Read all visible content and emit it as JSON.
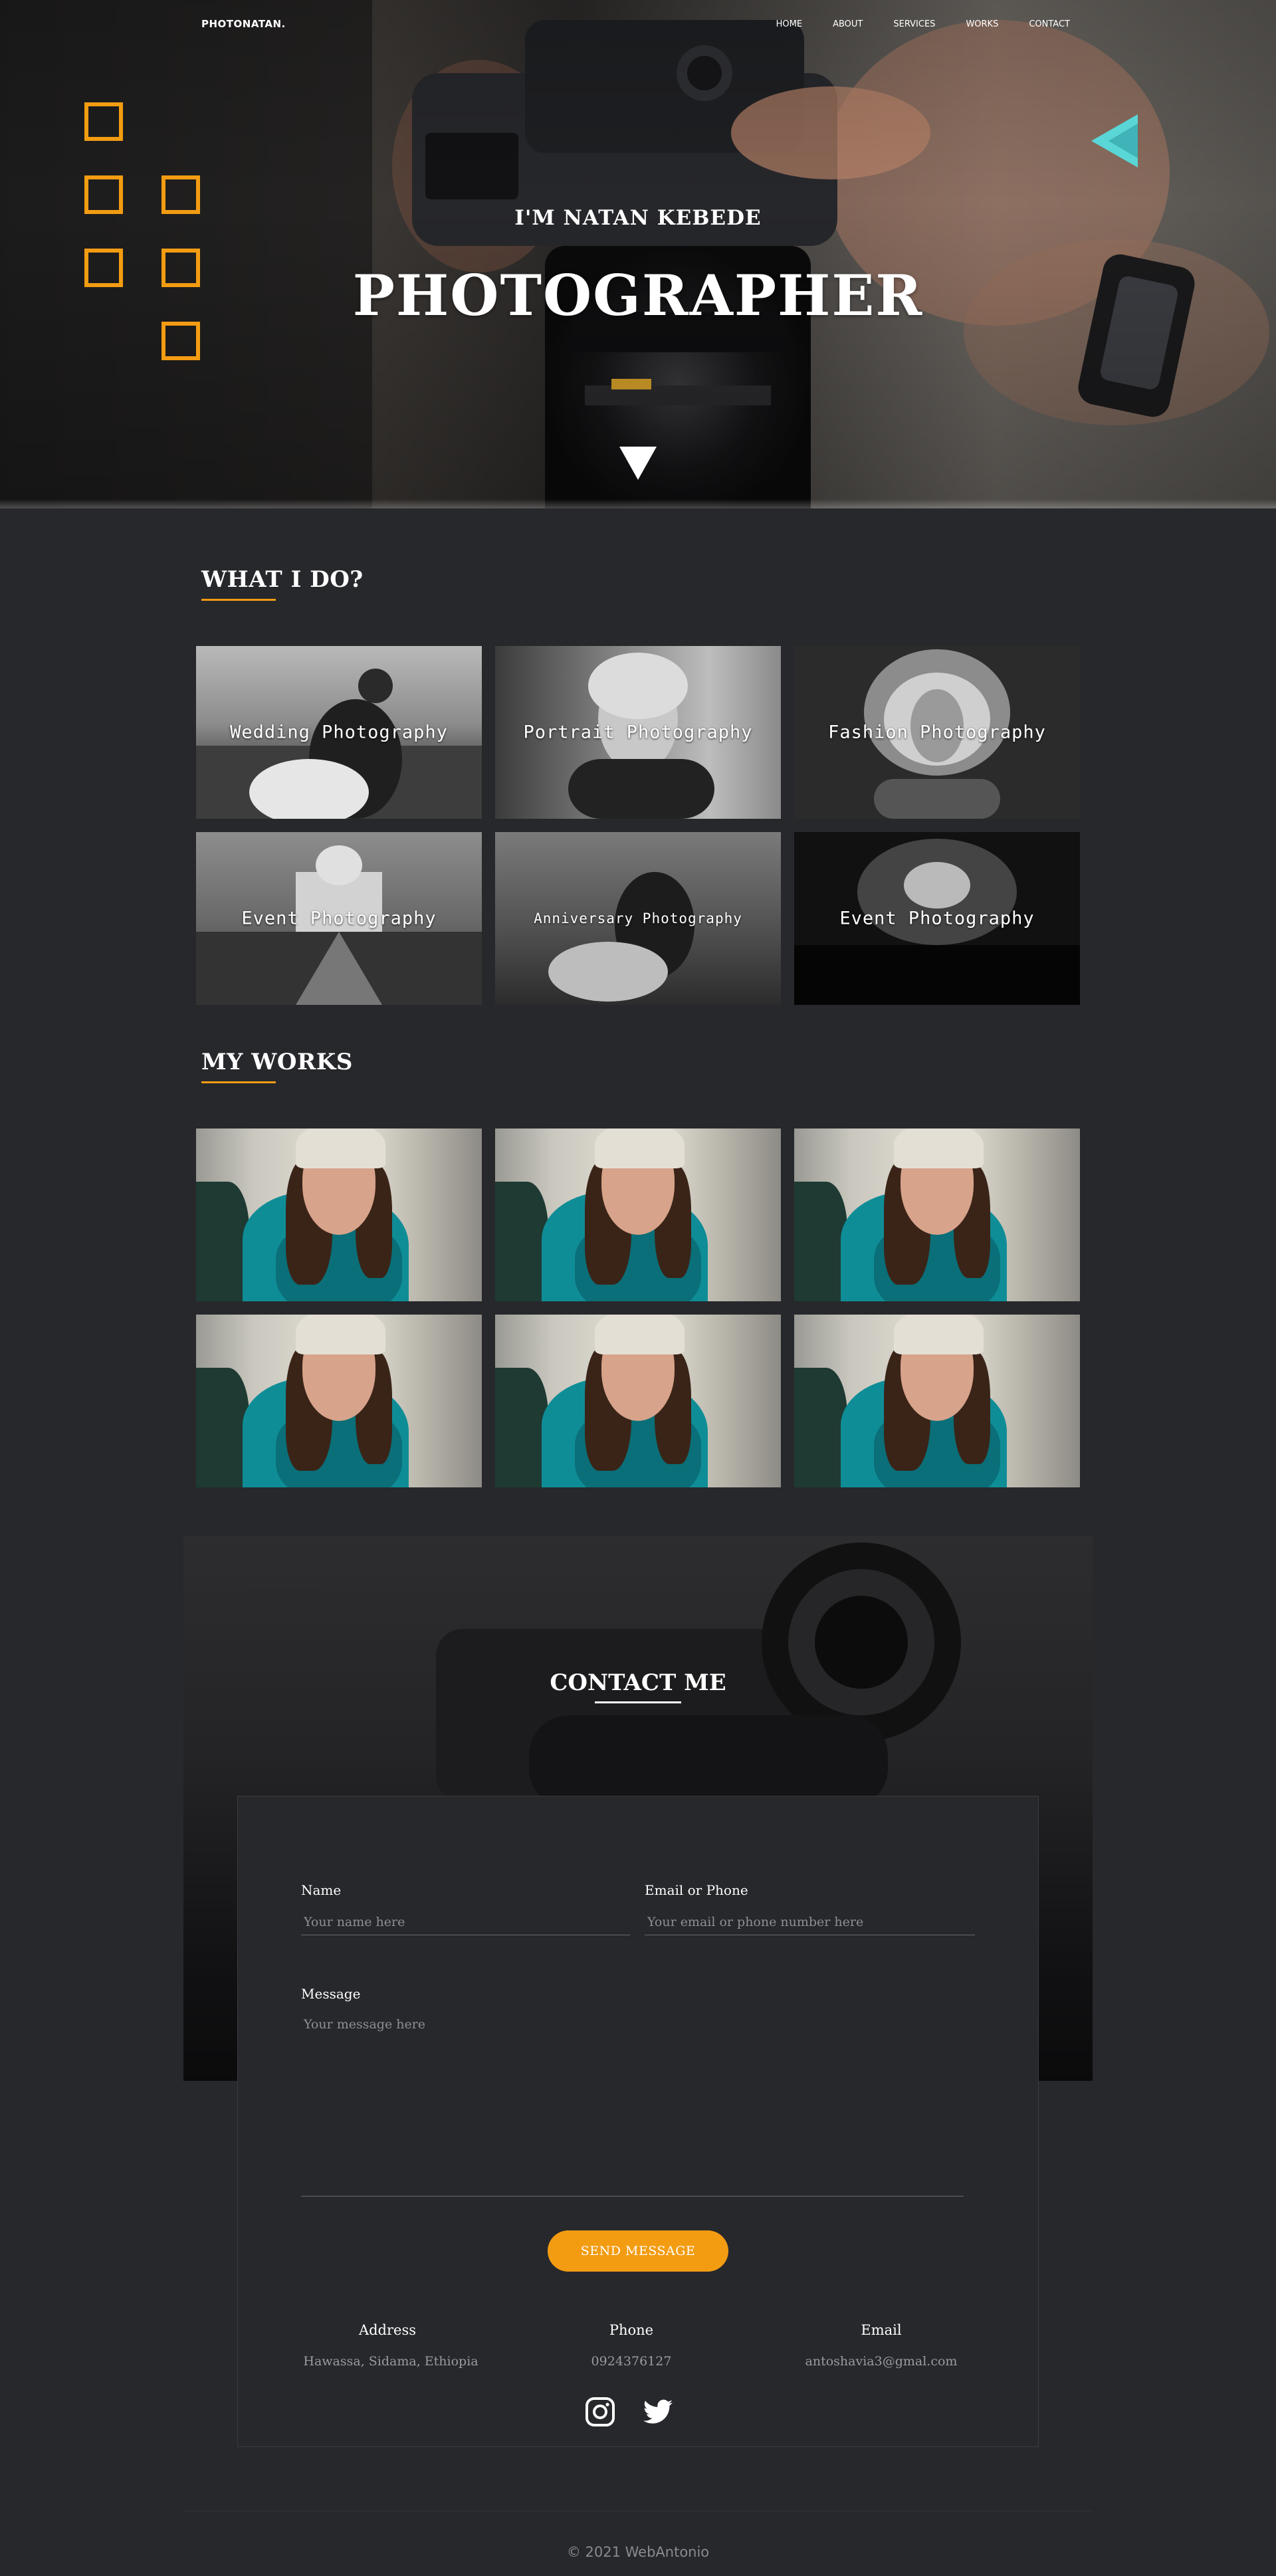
{
  "nav": {
    "brand": "PHOTONATAN.",
    "items": [
      {
        "label": "HOME"
      },
      {
        "label": "ABOUT"
      },
      {
        "label": "SERVICES"
      },
      {
        "label": "WORKS"
      },
      {
        "label": "CONTACT"
      }
    ]
  },
  "hero": {
    "subtitle": "I'M NATAN KEBEDE",
    "title": "PHOTOGRAPHER"
  },
  "services": {
    "title": "WHAT I DO?",
    "items": [
      {
        "label": "Wedding Photography"
      },
      {
        "label": "Portrait Photography"
      },
      {
        "label": "Fashion Photography"
      },
      {
        "label": "Event Photography"
      },
      {
        "label": "Anniversary Photography"
      },
      {
        "label": "Event Photography"
      }
    ]
  },
  "works": {
    "title": "MY WORKS",
    "count": 6
  },
  "contact": {
    "title": "CONTACT ME",
    "name_label": "Name",
    "name_placeholder": "Your name here",
    "email_label": "Email or Phone",
    "email_placeholder": "Your email or phone number here",
    "message_label": "Message",
    "message_placeholder": "Your message here",
    "send_label": "SEND MESSAGE",
    "info": [
      {
        "heading": "Address",
        "value": "Hawassa, Sidama, Ethiopia"
      },
      {
        "heading": "Phone",
        "value": "0924376127"
      },
      {
        "heading": "Email",
        "value": "antoshavia3@gmal.com"
      }
    ],
    "social": [
      "instagram-icon",
      "twitter-icon"
    ]
  },
  "footer": {
    "copyright": "© 2021 WebAntonio"
  },
  "colors": {
    "accent": "#f39c12",
    "background": "#27282c",
    "teal": "#5ad6d6"
  }
}
